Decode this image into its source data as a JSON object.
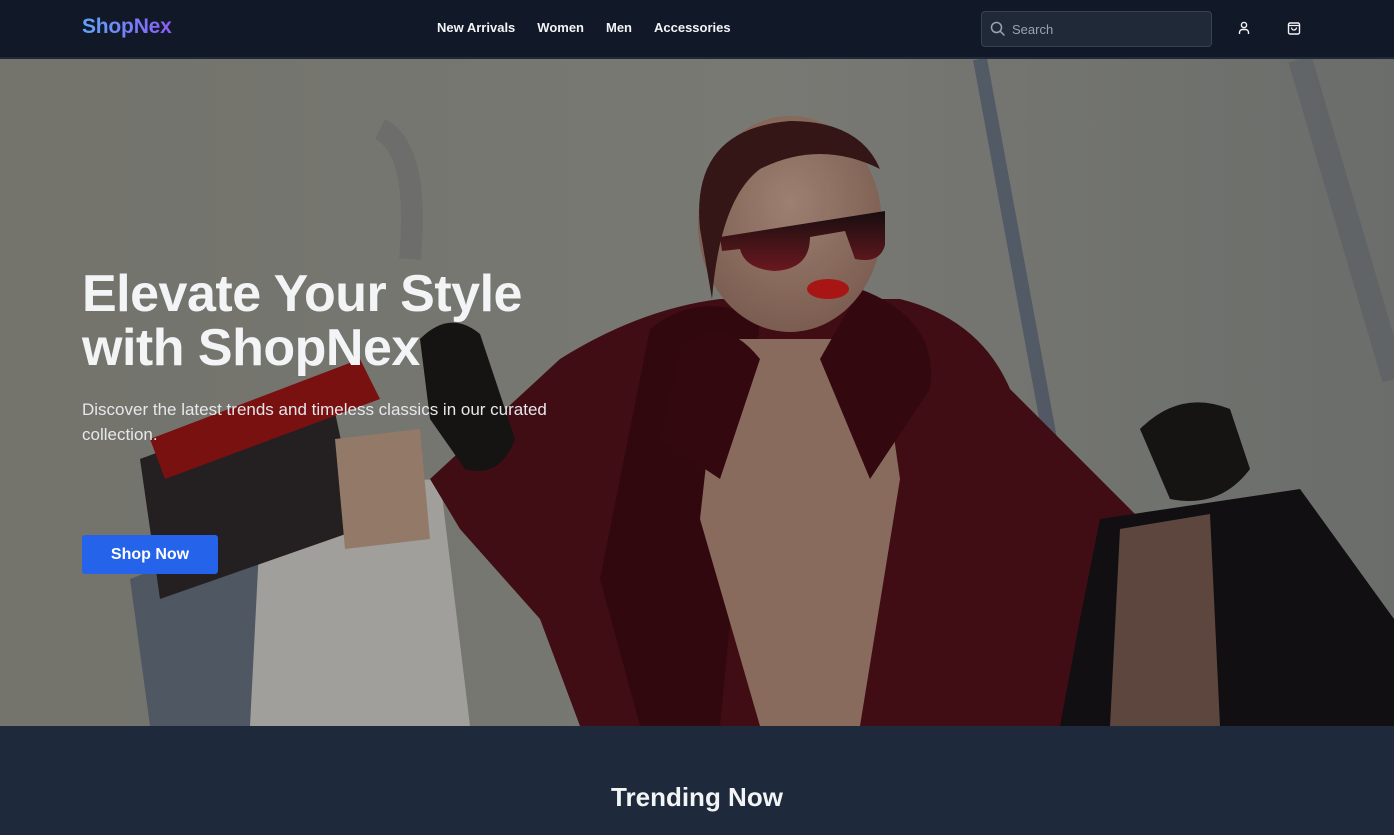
{
  "header": {
    "logo": "ShopNex",
    "nav": [
      {
        "label": "New Arrivals"
      },
      {
        "label": "Women"
      },
      {
        "label": "Men"
      },
      {
        "label": "Accessories"
      }
    ],
    "search": {
      "placeholder": "Search",
      "value": "",
      "icon": "search-icon"
    },
    "icons": {
      "account": "user-icon",
      "cart": "shopping-bag-icon"
    }
  },
  "hero": {
    "title_line1": "Elevate Your Style",
    "title_line2": "with ShopNex",
    "subtitle": "Discover the latest trends and timeless classics in our curated collection.",
    "cta_label": "Shop Now",
    "image_alt": "Woman in sunglasses and burgundy coat holding shopping bags"
  },
  "trending": {
    "title": "Trending Now"
  },
  "colors": {
    "header_bg": "#111827",
    "section_bg": "#1e293b",
    "accent": "#2563eb",
    "logo_gradient_start": "#60a5fa",
    "logo_gradient_end": "#8b5cf6"
  }
}
